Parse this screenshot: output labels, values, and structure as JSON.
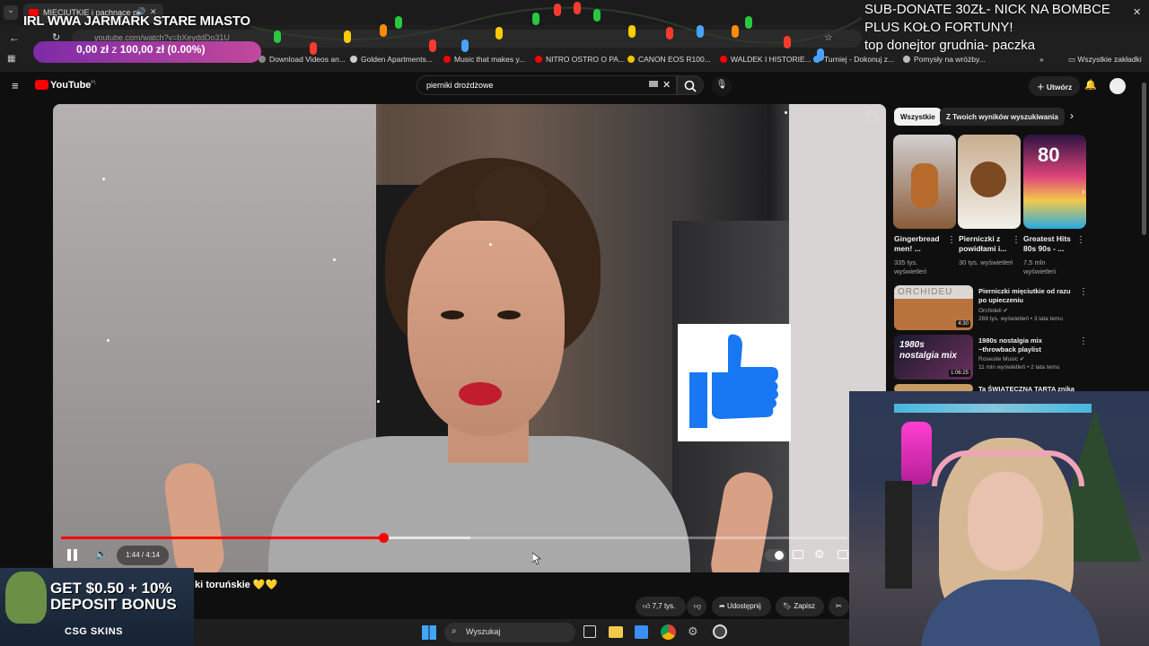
{
  "browser": {
    "tab_title": "MIĘCIUTKIE i pachnące pi",
    "address": "youtube.com/watch?v=bXeyddDo31U",
    "bookmarks": [
      {
        "label": "Download Videos an...",
        "color": "#888888"
      },
      {
        "label": "Golden Apartments...",
        "color": "#cccccc"
      },
      {
        "label": "Music that makes y...",
        "color": "#ff0000"
      },
      {
        "label": "NITRO OSTRO O PA...",
        "color": "#ff0000"
      },
      {
        "label": "CANON EOS R100...",
        "color": "#f2c200"
      },
      {
        "label": "WALDEK I HISTORIE...",
        "color": "#ff0000"
      },
      {
        "label": "Turniej - Dokonuj z...",
        "color": "#4aa3ff"
      },
      {
        "label": "Pomysły na wróżby...",
        "color": "#bbbbbb"
      }
    ],
    "all_bookmarks_label": "Wszystkie zakładki"
  },
  "youtube": {
    "logo_text": "YouTube",
    "logo_suffix": "PL",
    "search_value": "pierniki drożdżowe",
    "create_label": "Utwórz"
  },
  "player": {
    "time": "1:44 / 4:14",
    "progress": 0.41,
    "buffered": 0.52
  },
  "video_info": {
    "title_fragment": "ki toruńskie 💛💛",
    "like_count": "7,7 tys.",
    "share_label": "Udostępnij",
    "save_label": "Zapisz"
  },
  "sidebar": {
    "chips": [
      "Wszystkie",
      "Z Twoich wyników wyszukiwania"
    ],
    "shorts": [
      {
        "title": "Gingerbread men! ...",
        "views": "335 tys. wyświetleń"
      },
      {
        "title": "Pierniczki z powidłami i...",
        "views": "30 tys. wyświetleń"
      },
      {
        "title": "Greatest Hits 80s 90s - ...",
        "views": "7,5 mln wyświetleń"
      }
    ],
    "recommended": [
      {
        "title": "Pierniczki mięciutkie od razu po upieczeniu",
        "channel": "Orchideli",
        "meta": "269 tys. wyświetleń • 3 lata temu",
        "duration": "4:30",
        "thumb_text": "ORCHIDEU"
      },
      {
        "title": "1980s nostalgia mix ~throwback playlist",
        "channel": "Rosesite Music",
        "meta": "11 mln wyświetleń • 2 lata temu",
        "duration": "1:06:25",
        "thumb_text": "1980s nostalgia mix"
      },
      {
        "title": "Ta ŚWIĄTECZNA TARTA znika",
        "channel": "",
        "meta": "",
        "duration": "",
        "thumb_text": ""
      }
    ]
  },
  "stream_overlay": {
    "title": "IRL WWA JARMARK STARE MIASTO",
    "donate_current": "0,00 zł",
    "donate_sep": "z",
    "donate_goal": "100,00 zł",
    "donate_pct": "(0.00%)",
    "subdonate_lines": [
      "SUB-DONATE 30ZŁ- NICK NA BOMBCE",
      "PLUS KOŁO FORTUNY!",
      "top donejtor grudnia- paczka"
    ]
  },
  "ad": {
    "line1": "GET $0.50 + 10%",
    "line2": "DEPOSIT BONUS",
    "brand": "CSG SKINS"
  },
  "taskbar": {
    "search_placeholder": "Wyszukaj"
  },
  "colors": {
    "accent": "#ff0000",
    "like_blue": "#1877f2"
  }
}
